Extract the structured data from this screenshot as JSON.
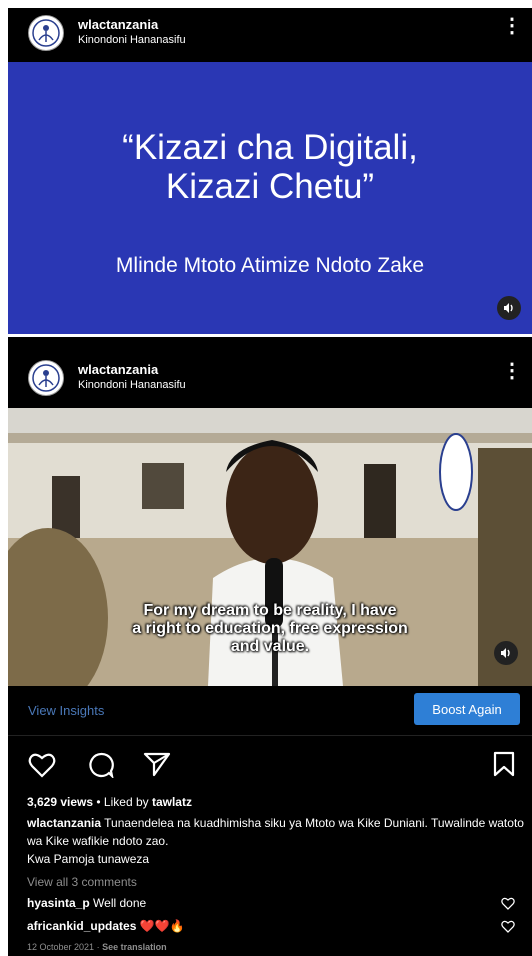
{
  "post1": {
    "username": "wlactanzania",
    "location": "Kinondoni Hananasifu",
    "more_glyph": "⋮",
    "slide": {
      "quote_line1": "“Kizazi cha Digitali,",
      "quote_line2": "Kizazi Chetu”",
      "tagline": "Mlinde Mtoto Atimize Ndoto Zake",
      "background": "#2a37b4"
    },
    "sound_icon": "speaker-icon"
  },
  "post2": {
    "username": "wlactanzania",
    "location": "Kinondoni Hananasifu",
    "more_glyph": "⋮",
    "video": {
      "caption_line1": "For my dream to be reality, I have",
      "caption_line2": "a right to education, free expression",
      "caption_line3": "and value."
    },
    "view_insights": "View Insights",
    "boost_again": "Boost Again",
    "action_icons": [
      "heart-icon",
      "comment-icon",
      "share-icon",
      "bookmark-icon"
    ],
    "views": "3,629 views",
    "liked_by_prefix": " • Liked by ",
    "liked_by_user": "tawlatz",
    "caption_user": "wlactanzania",
    "caption_text": " Tunaendelea na kuadhimisha siku ya  Mtoto wa Kike Duniani. Tuwalinde watoto wa Kike wafikie ndoto zao.",
    "caption_line2": "Kwa Pamoja tunaweza",
    "view_all_comments": "View all 3 comments",
    "comments": [
      {
        "user": "hyasinta_p",
        "text": " Well done"
      },
      {
        "user": "africankid_updates",
        "text": " ❤️❤️🔥"
      }
    ],
    "date": "12 October 2021",
    "see_translation": "See translation",
    "colors": {
      "accent": "#2e7fd6",
      "link": "#4a78b8",
      "muted": "#8e8e8e"
    }
  }
}
